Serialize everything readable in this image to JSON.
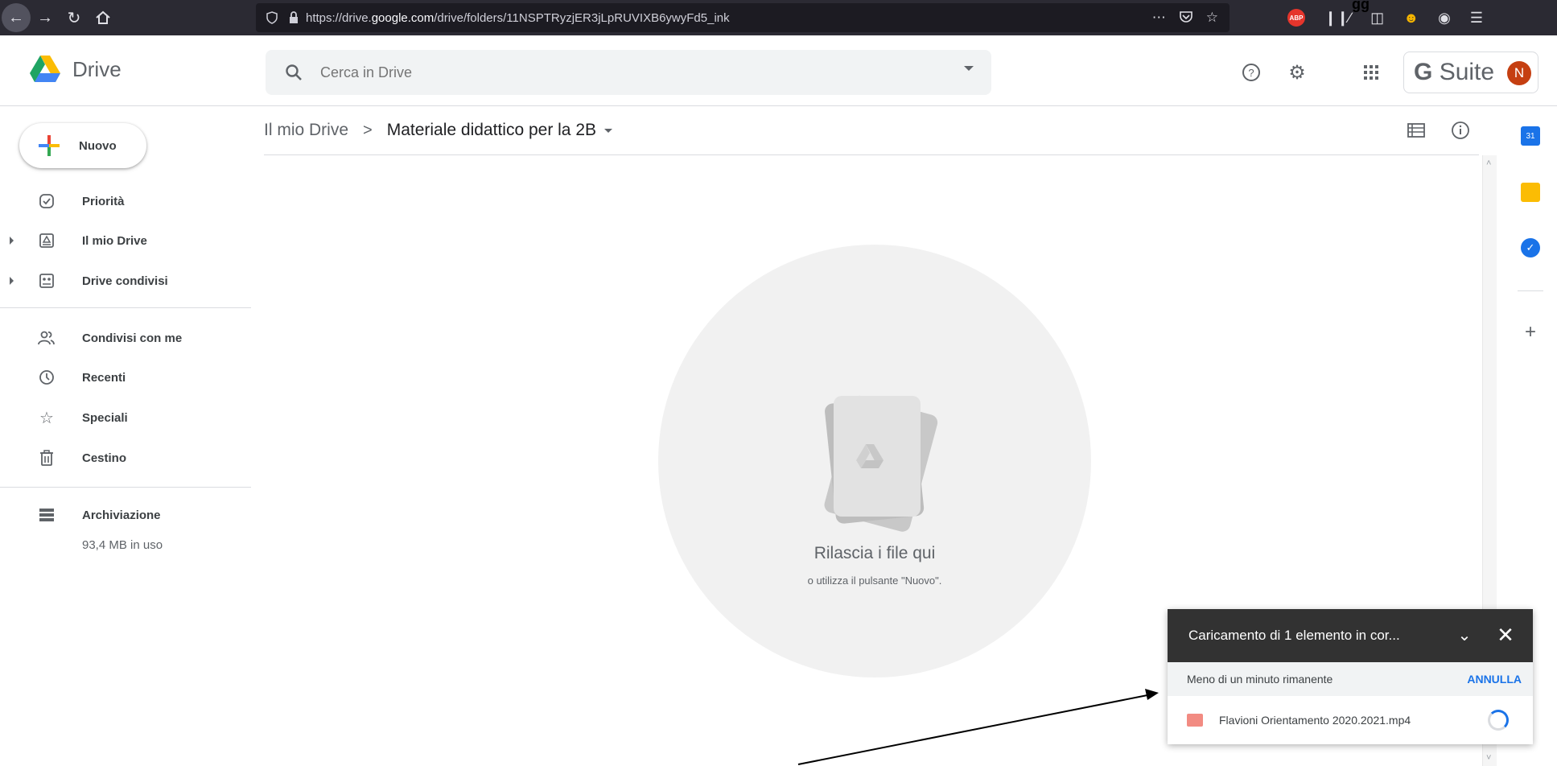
{
  "browser": {
    "url_prefix": "https://drive.",
    "url_host": "google.com",
    "url_path": "/drive/folders/11NSPTRyzjER3jLpRUVIXB6ywyFd5_ink",
    "stray_text": "gg",
    "abp_label": "ABP"
  },
  "header": {
    "app_name": "Drive",
    "search_placeholder": "Cerca in Drive",
    "gsuite_g": "G",
    "gsuite_label": "Suite",
    "avatar_initial": "N"
  },
  "sidebar": {
    "new_label": "Nuovo",
    "items": [
      {
        "label": "Priorità",
        "icon": "check-circle-icon"
      },
      {
        "label": "Il mio Drive",
        "icon": "my-drive-icon"
      },
      {
        "label": "Drive condivisi",
        "icon": "shared-drives-icon"
      },
      {
        "label": "Condivisi con me",
        "icon": "people-icon"
      },
      {
        "label": "Recenti",
        "icon": "clock-icon"
      },
      {
        "label": "Speciali",
        "icon": "star-icon"
      },
      {
        "label": "Cestino",
        "icon": "trash-icon"
      },
      {
        "label": "Archiviazione",
        "icon": "storage-icon"
      }
    ],
    "storage_used": "93,4 MB in uso"
  },
  "breadcrumb": {
    "root": "Il mio Drive",
    "separator": ">",
    "current": "Materiale didattico per la 2B"
  },
  "empty_state": {
    "title": "Rilascia i file qui",
    "subtitle": "o utilizza il pulsante \"Nuovo\"."
  },
  "side_panel": {
    "calendar_day": "31"
  },
  "upload": {
    "title": "Caricamento di 1 elemento in cor...",
    "status": "Meno di un minuto rimanente",
    "cancel_label": "ANNULLA",
    "file_name": "Flavioni Orientamento 2020.2021.mp4"
  },
  "colors": {
    "accent": "#1a73e8",
    "avatar": "#c53f11",
    "upload_header": "#323232"
  }
}
